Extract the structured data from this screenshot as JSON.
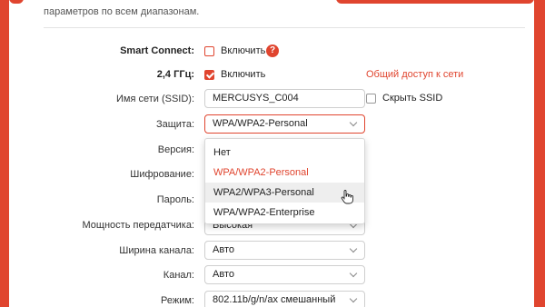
{
  "intro_text": "параметров по всем диапазонам.",
  "smart_connect": {
    "label": "Smart Connect:",
    "checkbox_label": "Включить",
    "checked": false,
    "help_symbol": "?"
  },
  "band": {
    "label": "2,4 ГГц:",
    "checkbox_label": "Включить",
    "checked": true,
    "share_link": "Общий доступ к сети"
  },
  "ssid": {
    "label": "Имя сети (SSID):",
    "value": "MERCUSYS_C004",
    "hide_label": "Скрыть SSID",
    "hide_checked": false
  },
  "security": {
    "label": "Защита:",
    "value": "WPA/WPA2-Personal",
    "options": [
      {
        "label": "Нет"
      },
      {
        "label": "WPA/WPA2-Personal",
        "selected": true
      },
      {
        "label": "WPA2/WPA3-Personal",
        "hovered": true
      },
      {
        "label": "WPA/WPA2-Enterprise"
      }
    ]
  },
  "version": {
    "label": "Версия:"
  },
  "encryption": {
    "label": "Шифрование:"
  },
  "password": {
    "label": "Пароль:"
  },
  "tx_power": {
    "label": "Мощность передатчика:",
    "value": "Высокая"
  },
  "channel_width": {
    "label": "Ширина канала:",
    "value": "Авто"
  },
  "channel": {
    "label": "Канал:",
    "value": "Авто"
  },
  "mode": {
    "label": "Режим:",
    "value": "802.11b/g/n/ax смешанный"
  },
  "colors": {
    "accent": "#e0452f",
    "background": "#ffffff"
  },
  "icons": {
    "help": "question-circle-icon",
    "chevron": "chevron-down-icon",
    "cursor": "hand-pointer-icon"
  }
}
